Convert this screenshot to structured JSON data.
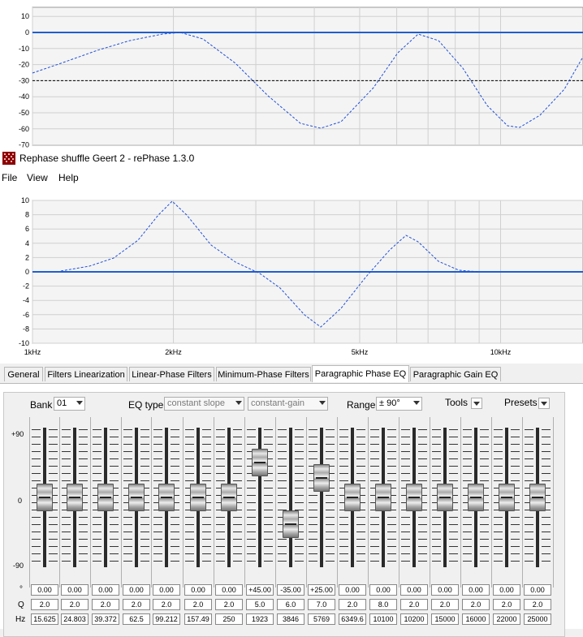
{
  "upper_plot": {
    "y_ticks": [
      "10",
      "0",
      "-10",
      "-20",
      "-30",
      "-40",
      "-50",
      "-60",
      "-70"
    ],
    "dashed_ref": -30
  },
  "lower_plot": {
    "y_ticks": [
      "10",
      "8",
      "6",
      "4",
      "2",
      "0",
      "-2",
      "-4",
      "-6",
      "-8",
      "-10"
    ],
    "x_ticks": [
      "1kHz",
      "2kHz",
      "5kHz",
      "10kHz"
    ]
  },
  "window": {
    "title": "Rephase shuffle Geert 2  -  rePhase 1.3.0",
    "menu": [
      "File",
      "View",
      "Help"
    ]
  },
  "tabs": [
    "General",
    "Filters Linearization",
    "Linear-Phase Filters",
    "Minimum-Phase Filters",
    "Paragraphic Phase EQ",
    "Paragraphic Gain EQ"
  ],
  "active_tab": "Paragraphic Phase EQ",
  "controls": {
    "bank_label": "Bank",
    "bank_value": "01",
    "eq_type_label": "EQ type",
    "eq_type_value": "constant slope",
    "eq_gain_value": "constant-gain",
    "range_label": "Range",
    "range_value": "± 90°",
    "tools_label": "Tools",
    "presets_label": "Presets"
  },
  "slider_axis": {
    "top": "+90",
    "mid": "0",
    "bottom": "-90"
  },
  "row_labels": {
    "phase": "°",
    "q": "Q",
    "hz": "Hz"
  },
  "bands": [
    {
      "phase": "0.00",
      "q": "2.0",
      "hz": "15.625",
      "value": 0
    },
    {
      "phase": "0.00",
      "q": "2.0",
      "hz": "24.803",
      "value": 0
    },
    {
      "phase": "0.00",
      "q": "2.0",
      "hz": "39.372",
      "value": 0
    },
    {
      "phase": "0.00",
      "q": "2.0",
      "hz": "62.5",
      "value": 0
    },
    {
      "phase": "0.00",
      "q": "2.0",
      "hz": "99.212",
      "value": 0
    },
    {
      "phase": "0.00",
      "q": "2.0",
      "hz": "157.49",
      "value": 0
    },
    {
      "phase": "0.00",
      "q": "2.0",
      "hz": "250",
      "value": 0
    },
    {
      "phase": "+45.00",
      "q": "5.0",
      "hz": "1923",
      "value": 45
    },
    {
      "phase": "-35.00",
      "q": "6.0",
      "hz": "3846",
      "value": -35
    },
    {
      "phase": "+25.00",
      "q": "7.0",
      "hz": "5769",
      "value": 25
    },
    {
      "phase": "0.00",
      "q": "2.0",
      "hz": "6349.6",
      "value": 0
    },
    {
      "phase": "0.00",
      "q": "8.0",
      "hz": "10100",
      "value": 0
    },
    {
      "phase": "0.00",
      "q": "2.0",
      "hz": "10200",
      "value": 0
    },
    {
      "phase": "0.00",
      "q": "2.0",
      "hz": "15000",
      "value": 0
    },
    {
      "phase": "0.00",
      "q": "2.0",
      "hz": "16000",
      "value": 0
    },
    {
      "phase": "0.00",
      "q": "2.0",
      "hz": "22000",
      "value": 0
    },
    {
      "phase": "0.00",
      "q": "2.0",
      "hz": "25000",
      "value": 0
    }
  ],
  "colors": {
    "curve": "#1f4fd6",
    "zero_line": "#1f5fcf",
    "grid": "#d0d0d0"
  }
}
